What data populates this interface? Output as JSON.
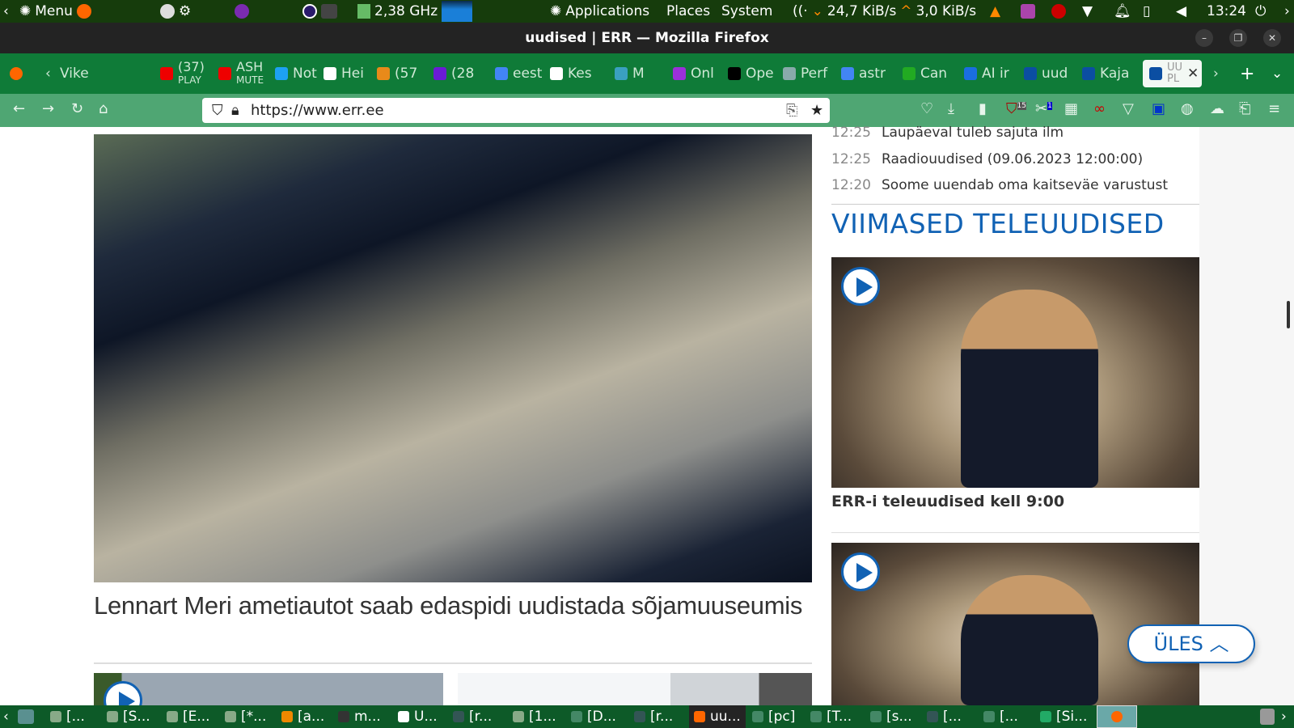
{
  "panel": {
    "menu": "Menu",
    "cpu": "2,38 GHz",
    "applications": "Applications",
    "places": "Places",
    "system": "System",
    "down": "24,7 KiB/s",
    "up": "3,0 KiB/s",
    "clock": "13:24"
  },
  "window": {
    "title": "uudised | ERR — Mozilla Firefox"
  },
  "tabs": [
    {
      "label": "Vike",
      "color": "#0f7b38"
    },
    {
      "label": "(37)",
      "sub": "PLAY",
      "color": "#e00"
    },
    {
      "label": "ASH",
      "sub": "MUTE",
      "color": "#e00"
    },
    {
      "label": "Not",
      "color": "#1da1f2"
    },
    {
      "label": "Hei",
      "color": "#fff"
    },
    {
      "label": "(57",
      "color": "#e88a1a"
    },
    {
      "label": "(28",
      "color": "#6a1bd6"
    },
    {
      "label": "eest",
      "color": "#4285f4"
    },
    {
      "label": "Kes",
      "color": "#fff"
    },
    {
      "label": "M",
      "color": "#3aa0c0"
    },
    {
      "label": "Onl",
      "color": "#9b30d9"
    },
    {
      "label": "Ope",
      "color": "#000"
    },
    {
      "label": "Perf",
      "color": "#8aa"
    },
    {
      "label": "astr",
      "color": "#4285f4"
    },
    {
      "label": "Can",
      "color": "#2a2"
    },
    {
      "label": "AI ir",
      "color": "#1a6ee0"
    },
    {
      "label": "uud",
      "color": "#0b4ea2"
    },
    {
      "label": "Kaja",
      "color": "#0b4ea2"
    }
  ],
  "active_tab": {
    "label": "UU",
    "sub": "PL"
  },
  "nav": {
    "url": "https://www.err.ee",
    "badge_ublock": "15",
    "badge_ext": "1"
  },
  "main": {
    "headline": "Lennart Meri ametiautot saab edaspidi uudistada sõjamuuseumis"
  },
  "news": [
    {
      "time": "12:25",
      "title": "Laupäeval tuleb sajuta ilm"
    },
    {
      "time": "12:25",
      "title": "Raadiouudised (09.06.2023 12:00:00)"
    },
    {
      "time": "12:20",
      "title": "Soome uuendab oma kaitseväe varustust"
    }
  ],
  "tv": {
    "heading": "VIIMASED TELEUUDISED",
    "caption": "ERR-i teleuudised kell 9:00"
  },
  "ules": "ÜLES",
  "taskbar": [
    "[...",
    "[S...",
    "[E...",
    "[*...",
    "[a...",
    "m...",
    "U...",
    "[r...",
    "[1...",
    "[D...",
    "[r...",
    "uu...",
    "[pc]",
    "[T...",
    "[s...",
    "[...",
    "[...",
    "[Si..."
  ],
  "colors": {
    "accent": "#1162b4",
    "panel": "#163c0c",
    "tabbar": "#0f7b38",
    "navbar": "#4fa673"
  }
}
